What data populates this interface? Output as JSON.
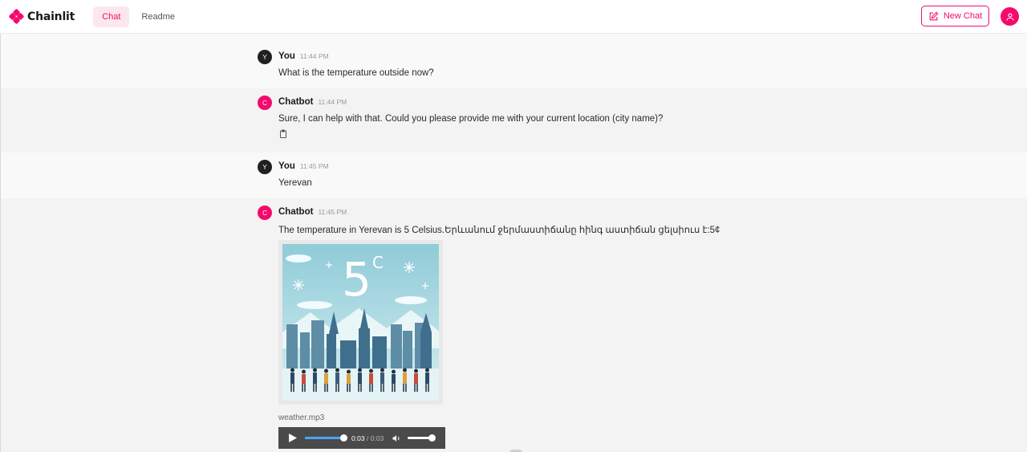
{
  "app": {
    "name": "Chainlit",
    "brand_color": "#f50a6c",
    "tabs": [
      {
        "label": "Chat",
        "active": true
      },
      {
        "label": "Readme",
        "active": false
      }
    ],
    "new_chat_label": "New Chat",
    "new_chat_icon": "edit-icon",
    "user_icon": "user-icon"
  },
  "messages": [
    {
      "role": "user",
      "avatar": "Y",
      "author": "You",
      "time": "11:44 PM",
      "text": "What is the temperature outside now?"
    },
    {
      "role": "bot",
      "avatar": "C",
      "author": "Chatbot",
      "time": "11:44 PM",
      "text": "Sure, I can help with that. Could you please provide me with your current location (city name)?",
      "action_icon": "clipboard-icon"
    },
    {
      "role": "user",
      "avatar": "Y",
      "author": "You",
      "time": "11:45 PM",
      "text": "Yerevan"
    },
    {
      "role": "bot",
      "avatar": "C",
      "author": "Chatbot",
      "time": "11:45 PM",
      "text": "The temperature in Yerevan is 5 Celsius.Երևանում ջերմաստիճանը հինգ աստիճան ցելսիուս է:5¢"
    }
  ],
  "weather_image": {
    "caption_value": "5",
    "caption_unit": "C"
  },
  "audio": {
    "filename": "weather.mp3",
    "current_time": "0:03",
    "separator": "/",
    "duration": "0:03",
    "progress": 1.0,
    "volume": 1.0
  }
}
